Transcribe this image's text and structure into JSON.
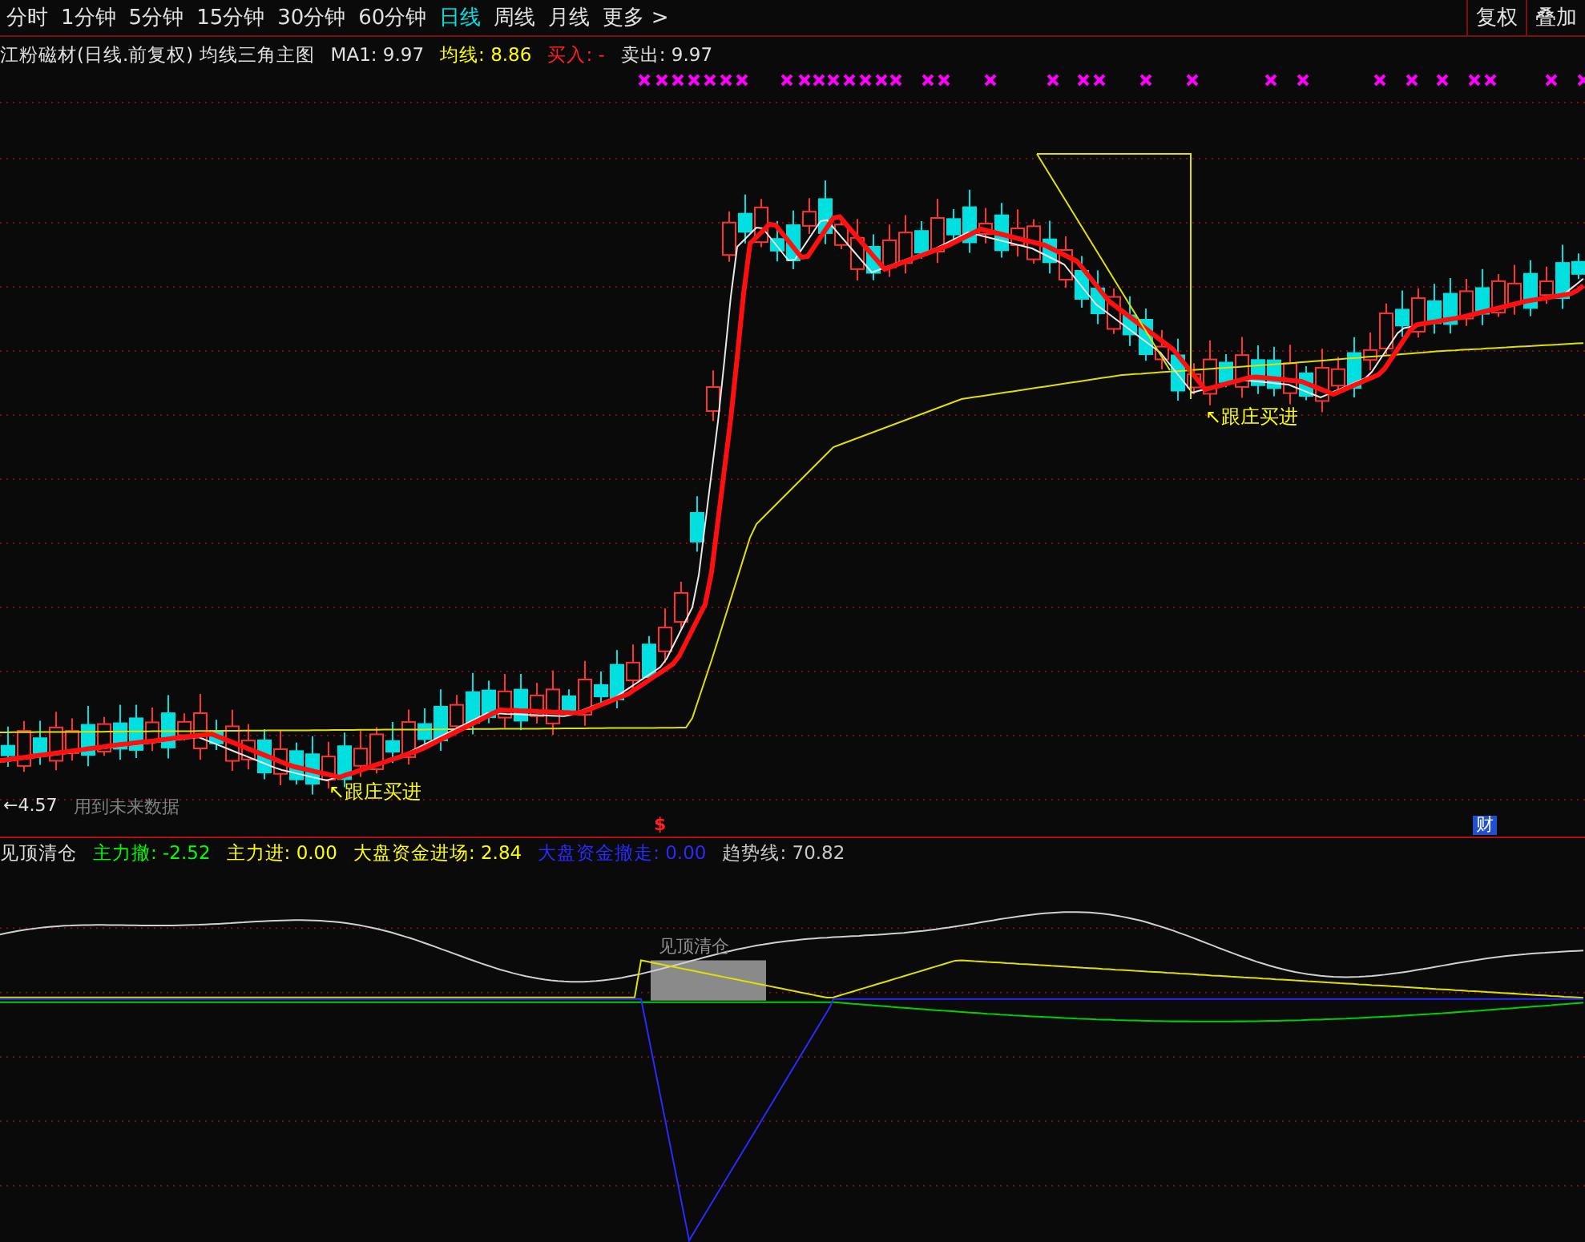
{
  "period_tabs": [
    {
      "label": "分时",
      "selected": false
    },
    {
      "label": "1分钟",
      "selected": false
    },
    {
      "label": "5分钟",
      "selected": false
    },
    {
      "label": "15分钟",
      "selected": false
    },
    {
      "label": "30分钟",
      "selected": false
    },
    {
      "label": "60分钟",
      "selected": false
    },
    {
      "label": "日线",
      "selected": true
    },
    {
      "label": "周线",
      "selected": false
    },
    {
      "label": "月线",
      "selected": false
    },
    {
      "label": "更多 >",
      "selected": false
    }
  ],
  "toolbar_buttons": [
    "复权",
    "叠加"
  ],
  "main_legend": {
    "title": "江粉磁材(日线.前复权) 均线三角主图",
    "items": [
      {
        "text": "MA1: 9.97",
        "color": "#e0e0e0"
      },
      {
        "text": "均线: 8.86",
        "color": "#ffff00"
      },
      {
        "text": "买入: -",
        "color": "#ff2020"
      },
      {
        "text": "卖出: 9.97",
        "color": "#e0e0e0"
      }
    ]
  },
  "main_chart": {
    "annotations": [
      "↖跟庄买进",
      "↖跟庄买进"
    ],
    "low_marker": "←4.57",
    "notice": "用到未来数据",
    "event_marks": [
      {
        "text": "$",
        "color": "#ff2020"
      },
      {
        "text": "财",
        "color": "#2050d0"
      }
    ]
  },
  "indicator_legend": {
    "title": "见顶清仓",
    "items": [
      {
        "text": "主力撤: -2.52",
        "color": "#00ff00"
      },
      {
        "text": "主力进: 0.00",
        "color": "#ffff00"
      },
      {
        "text": "大盘资金进场: 2.84",
        "color": "#ffff00"
      },
      {
        "text": "大盘资金撤走: 0.00",
        "color": "#2a2aff"
      },
      {
        "text": "趋势线: 70.82",
        "color": "#c8c8c8"
      }
    ]
  },
  "indicator_chart": {
    "bar_label": "见顶清仓"
  }
}
